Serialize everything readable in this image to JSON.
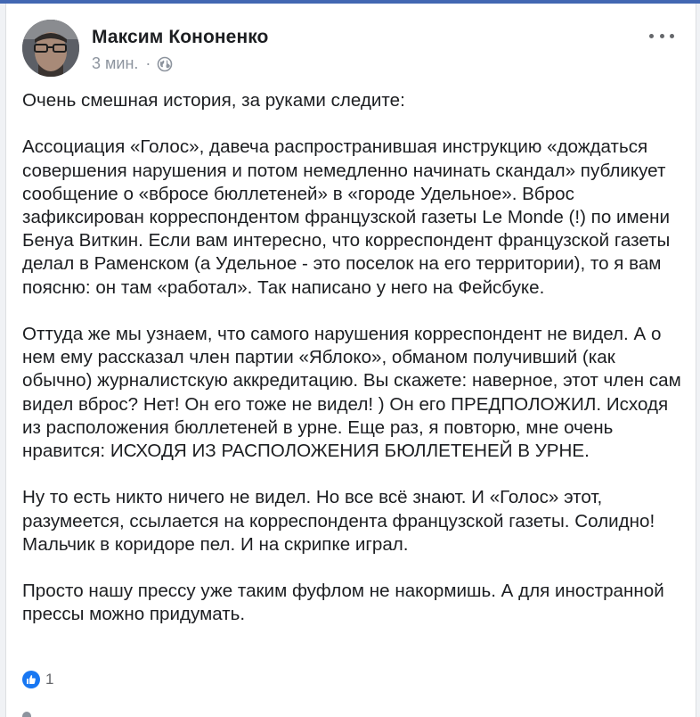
{
  "post": {
    "author": "Максим Кононенко",
    "time": "3 мин.",
    "separator": "·",
    "privacy_icon": "globe-icon",
    "paragraphs": [
      "Очень смешная история, за руками следите:",
      "Ассоциация «Голос», давеча распространившая инструкцию «дождаться совершения нарушения и потом немедленно начинать скандал» публикует сообщение о «вбросе бюллетеней» в «городе Удельное». Вброс зафиксирован корреспондентом французской газеты Le Monde (!) по имени Бенуа Виткин. Если вам интересно, что корреспондент французской газеты делал в Раменском (а Удельное - это поселок на его территории), то я вам поясню: он там «работал». Так написано у него на Фейсбуке.",
      "Оттуда же мы узнаем, что самого нарушения корреспондент не видел. А о нем ему рассказал член партии «Яблоко», обманом получивший (как обычно) журналистскую аккредитацию. Вы скажете: наверное, этот член сам видел вброс? Нет! Он его тоже не видел! ) Он его ПРЕДПОЛОЖИЛ. Исходя из расположения бюллетеней в урне. Еще раз, я повторю, мне очень нравится: ИСХОДЯ ИЗ РАСПОЛОЖЕНИЯ БЮЛЛЕТЕНЕЙ В УРНЕ.",
      "Ну то есть никто ничего не видел. Но все всё знают. И «Голос» этот, разумеется, ссылается на корреспондента французской газеты. Солидно! Мальчик в коридоре пел. И на скрипке играл.",
      "Просто нашу прессу уже таким фуфлом не накормишь. А для иностранной прессы можно придумать."
    ],
    "reaction_count": "1",
    "reaction_icon": "like-icon"
  },
  "colors": {
    "brand": "#4267b2",
    "like": "#1877f2",
    "text": "#1c1e21",
    "meta": "#8d949e"
  }
}
